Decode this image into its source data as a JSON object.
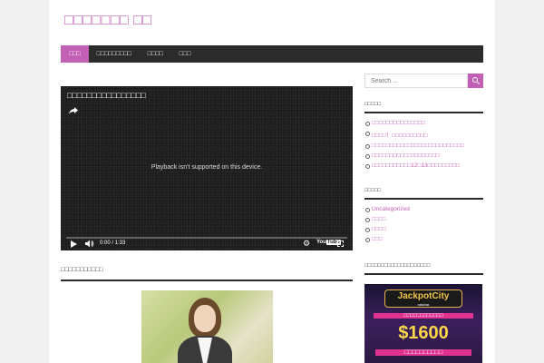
{
  "site": {
    "title": "□□□□□□□ □□"
  },
  "nav": {
    "items": [
      {
        "label": "□□□",
        "active": true
      },
      {
        "label": "□□□□□□□□□",
        "active": false
      },
      {
        "label": "□□□□",
        "active": false
      },
      {
        "label": "□□□",
        "active": false
      }
    ]
  },
  "video": {
    "title": "□□□□□□□□□□□□□□□□",
    "message": "Playback isn't supported on this device.",
    "time": "0:00 / 1:33",
    "youtube_label": "You",
    "youtube_label_box": "Tube"
  },
  "post": {
    "heading": "□□□□□□□□□□□"
  },
  "search": {
    "placeholder": "Search ..."
  },
  "widgets": {
    "recent": {
      "title": "□□□□□",
      "items": [
        "□□□□□□□□□□□□□□□",
        "□□□□！□□□□□□□□□□",
        "□□□□□□□□□□□□□□□□□□□□□□□□□□",
        "□□□□□□□□□□□□□□□□□□□",
        "□□□□□□□□□□□12□13□□□□□□□□□"
      ]
    },
    "categories": {
      "title": "□□□□□",
      "items": [
        "Uncategorized",
        "□□□□",
        "□□□□",
        "□□□"
      ]
    },
    "ad": {
      "title": "□□□□□□□□□□□□□□□□□□□□",
      "logo": "JackpotCity",
      "logo_sub": "casino",
      "tagline": "□□□□□□□□□□□□",
      "amount": "$1600",
      "bonus": "□□□□□□□□□□"
    }
  },
  "colors": {
    "accent": "#c45fb6",
    "nav_bg": "#2b2b2b"
  }
}
